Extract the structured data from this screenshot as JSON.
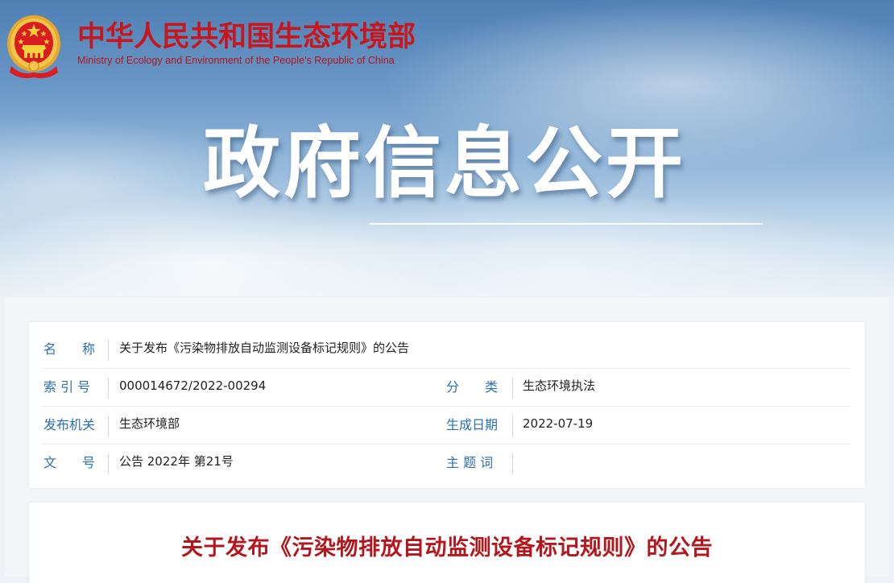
{
  "header": {
    "ministry_cn": "中华人民共和国生态环境部",
    "ministry_en": "Ministry of Ecology and Environment of the People's Republic of China",
    "banner_title": "政府信息公开",
    "emblem_icon": "national-emblem-icon"
  },
  "info": {
    "name_label": "名　　称",
    "name_value": "关于发布《污染物排放自动监测设备标记规则》的公告",
    "index_label": "索 引 号",
    "index_value": "000014672/2022-00294",
    "category_label": "分　　类",
    "category_value": "生态环境执法",
    "issuer_label": "发布机关",
    "issuer_value": "生态环境部",
    "date_label": "生成日期",
    "date_value": "2022-07-19",
    "doc_no_label": "文　　号",
    "doc_no_value": "公告 2022年 第21号",
    "keywords_label": "主 题 词",
    "keywords_value": ""
  },
  "article": {
    "title": "关于发布《污染物排放自动监测设备标记规则》的公告"
  },
  "colors": {
    "brand_red": "#c8161d",
    "label_blue": "#2b6fb6",
    "title_red": "#b3161c"
  }
}
